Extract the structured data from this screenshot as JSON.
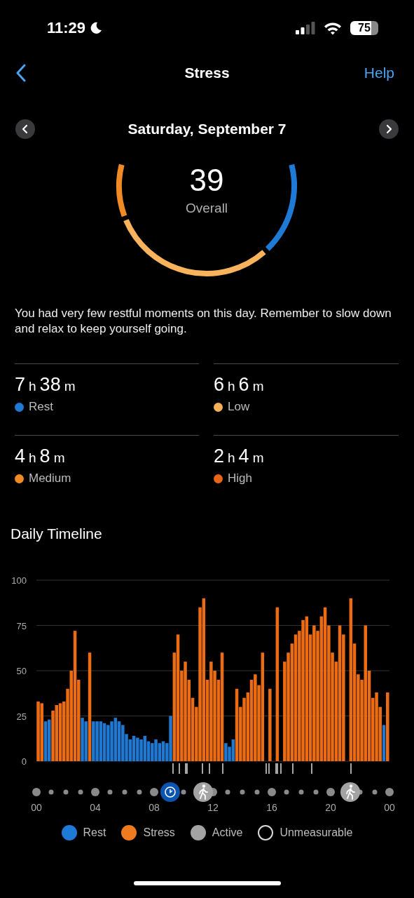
{
  "status_bar": {
    "time": "11:29",
    "battery": "75"
  },
  "header": {
    "title": "Stress",
    "action": "Help"
  },
  "date_nav": {
    "date": "Saturday, September 7"
  },
  "gauge": {
    "score": "39",
    "label": "Overall"
  },
  "summary": "You had very few restful moments on this day. Remember to slow down and relax to keep yourself going.",
  "stats": [
    {
      "label": "Rest",
      "color": "#1f7ad6",
      "duration": [
        {
          "n": "7",
          "unit": "h"
        },
        {
          "n": "38",
          "unit": "m"
        }
      ]
    },
    {
      "label": "Low",
      "color": "#f5b158",
      "duration": [
        {
          "n": "6",
          "unit": "h"
        },
        {
          "n": "6",
          "unit": "m"
        }
      ]
    },
    {
      "label": "Medium",
      "color": "#f08a24",
      "duration": [
        {
          "n": "4",
          "unit": "h"
        },
        {
          "n": "8",
          "unit": "m"
        }
      ]
    },
    {
      "label": "High",
      "color": "#e8661a",
      "duration": [
        {
          "n": "2",
          "unit": "h"
        },
        {
          "n": "4",
          "unit": "m"
        }
      ]
    }
  ],
  "timeline": {
    "title": "Daily Timeline",
    "chart_data": {
      "type": "bar",
      "grid": true,
      "xlim": [
        0,
        24
      ],
      "ylim": [
        0,
        100
      ],
      "yticks": [
        0,
        25,
        50,
        75,
        100
      ],
      "xticks": [
        {
          "value": 0,
          "label": "00"
        },
        {
          "value": 4,
          "label": "04"
        },
        {
          "value": 8,
          "label": "08"
        },
        {
          "value": 12,
          "label": "12"
        },
        {
          "value": 16,
          "label": "16"
        },
        {
          "value": 20,
          "label": "20"
        },
        {
          "value": 24,
          "label": "00"
        }
      ],
      "x": [
        0,
        0.25,
        0.5,
        0.75,
        1,
        1.25,
        1.5,
        1.75,
        2,
        2.25,
        2.5,
        2.75,
        3,
        3.25,
        3.5,
        3.75,
        4,
        4.25,
        4.5,
        4.75,
        5,
        5.25,
        5.5,
        5.75,
        6,
        6.25,
        6.5,
        6.75,
        7,
        7.25,
        7.5,
        7.75,
        8,
        8.25,
        8.5,
        8.75,
        9,
        9.25,
        9.5,
        9.75,
        10,
        10.25,
        10.5,
        10.75,
        11,
        11.25,
        11.5,
        11.75,
        12,
        12.25,
        12.5,
        12.75,
        13,
        13.25,
        13.5,
        13.75,
        14,
        14.25,
        14.5,
        14.75,
        15,
        15.25,
        15.5,
        15.75,
        16,
        16.25,
        16.5,
        16.75,
        17,
        17.25,
        17.5,
        17.75,
        18,
        18.25,
        18.5,
        18.75,
        19,
        19.25,
        19.5,
        19.75,
        20,
        20.25,
        20.5,
        20.75,
        21,
        21.25,
        21.5,
        21.75,
        22,
        22.25,
        22.5,
        22.75,
        23,
        23.25,
        23.5,
        23.75
      ],
      "series": [
        {
          "color": "#ec6c14",
          "values": [
            33,
            32,
            null,
            null,
            28,
            31,
            32,
            33,
            40,
            50,
            72,
            45,
            null,
            null,
            60,
            null,
            null,
            null,
            null,
            null,
            null,
            null,
            null,
            null,
            null,
            null,
            null,
            null,
            null,
            null,
            null,
            null,
            null,
            null,
            null,
            null,
            null,
            60,
            70,
            50,
            55,
            45,
            35,
            30,
            85,
            90,
            45,
            55,
            50,
            45,
            60,
            null,
            null,
            null,
            40,
            30,
            35,
            38,
            45,
            48,
            42,
            60,
            null,
            40,
            null,
            85,
            null,
            55,
            60,
            65,
            70,
            72,
            78,
            80,
            70,
            75,
            72,
            80,
            85,
            75,
            60,
            55,
            75,
            70,
            null,
            90,
            65,
            48,
            45,
            75,
            50,
            35,
            38,
            30,
            null,
            38
          ]
        },
        {
          "color": "#1f78d1",
          "values": [
            null,
            null,
            22,
            23,
            null,
            null,
            null,
            null,
            null,
            null,
            null,
            null,
            24,
            22,
            null,
            22,
            22,
            22,
            21,
            20,
            22,
            24,
            22,
            20,
            15,
            12,
            14,
            13,
            12,
            14,
            11,
            10,
            12,
            10,
            11,
            10,
            25,
            null,
            null,
            null,
            null,
            null,
            null,
            null,
            null,
            null,
            null,
            null,
            null,
            null,
            null,
            10,
            8,
            12,
            null,
            null,
            null,
            null,
            null,
            null,
            null,
            null,
            null,
            null,
            null,
            null,
            null,
            null,
            null,
            null,
            null,
            null,
            null,
            null,
            null,
            null,
            null,
            null,
            null,
            null,
            null,
            null,
            null,
            null,
            null,
            null,
            null,
            null,
            null,
            null,
            null,
            null,
            null,
            null,
            20,
            null
          ]
        }
      ]
    }
  },
  "legend": [
    {
      "label": "Rest",
      "color": "#1f7ad6",
      "kind": "filled"
    },
    {
      "label": "Stress",
      "color": "#f07b1f",
      "kind": "filled"
    },
    {
      "label": "Active",
      "color": "#a3a3a3",
      "kind": "filled"
    },
    {
      "label": "Unmeasurable",
      "color": "#d8d8d8",
      "kind": "outline"
    }
  ]
}
